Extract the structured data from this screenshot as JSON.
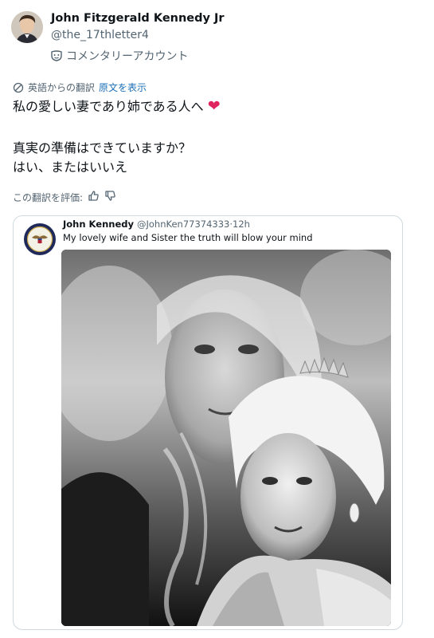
{
  "author": {
    "display_name": "John Fitzgerald Kennedy Jr",
    "handle": "@the_17thletter4",
    "account_label": "コメンタリーアカウント",
    "avatar_icon": "profile-photo",
    "account_icon": "mask-icon"
  },
  "translation": {
    "notice": "英語からの翻訳",
    "show_original": "原文を表示",
    "icon": "translate-icon",
    "link_color": "#1d6fb8"
  },
  "tweet": {
    "line1": "私の愛しい妻であり姉である人へ",
    "heart_emoji": "❤",
    "heart_color": "#e0245e",
    "line2": "真実の準備はできていますか？",
    "line3": "はい、またはいいえ"
  },
  "rating": {
    "label": "この翻訳を評価:",
    "thumbs_up_icon": "thumbs-up-icon",
    "thumbs_down_icon": "thumbs-down-icon"
  },
  "quoted_tweet": {
    "display_name": "John Kennedy",
    "handle_time": "@JohnKen77374333·12h",
    "text": "My lovely wife and Sister the truth will blow your mind",
    "avatar_icon": "presidential-seal-icon",
    "image": "black-and-white-double-exposure-portrait"
  }
}
